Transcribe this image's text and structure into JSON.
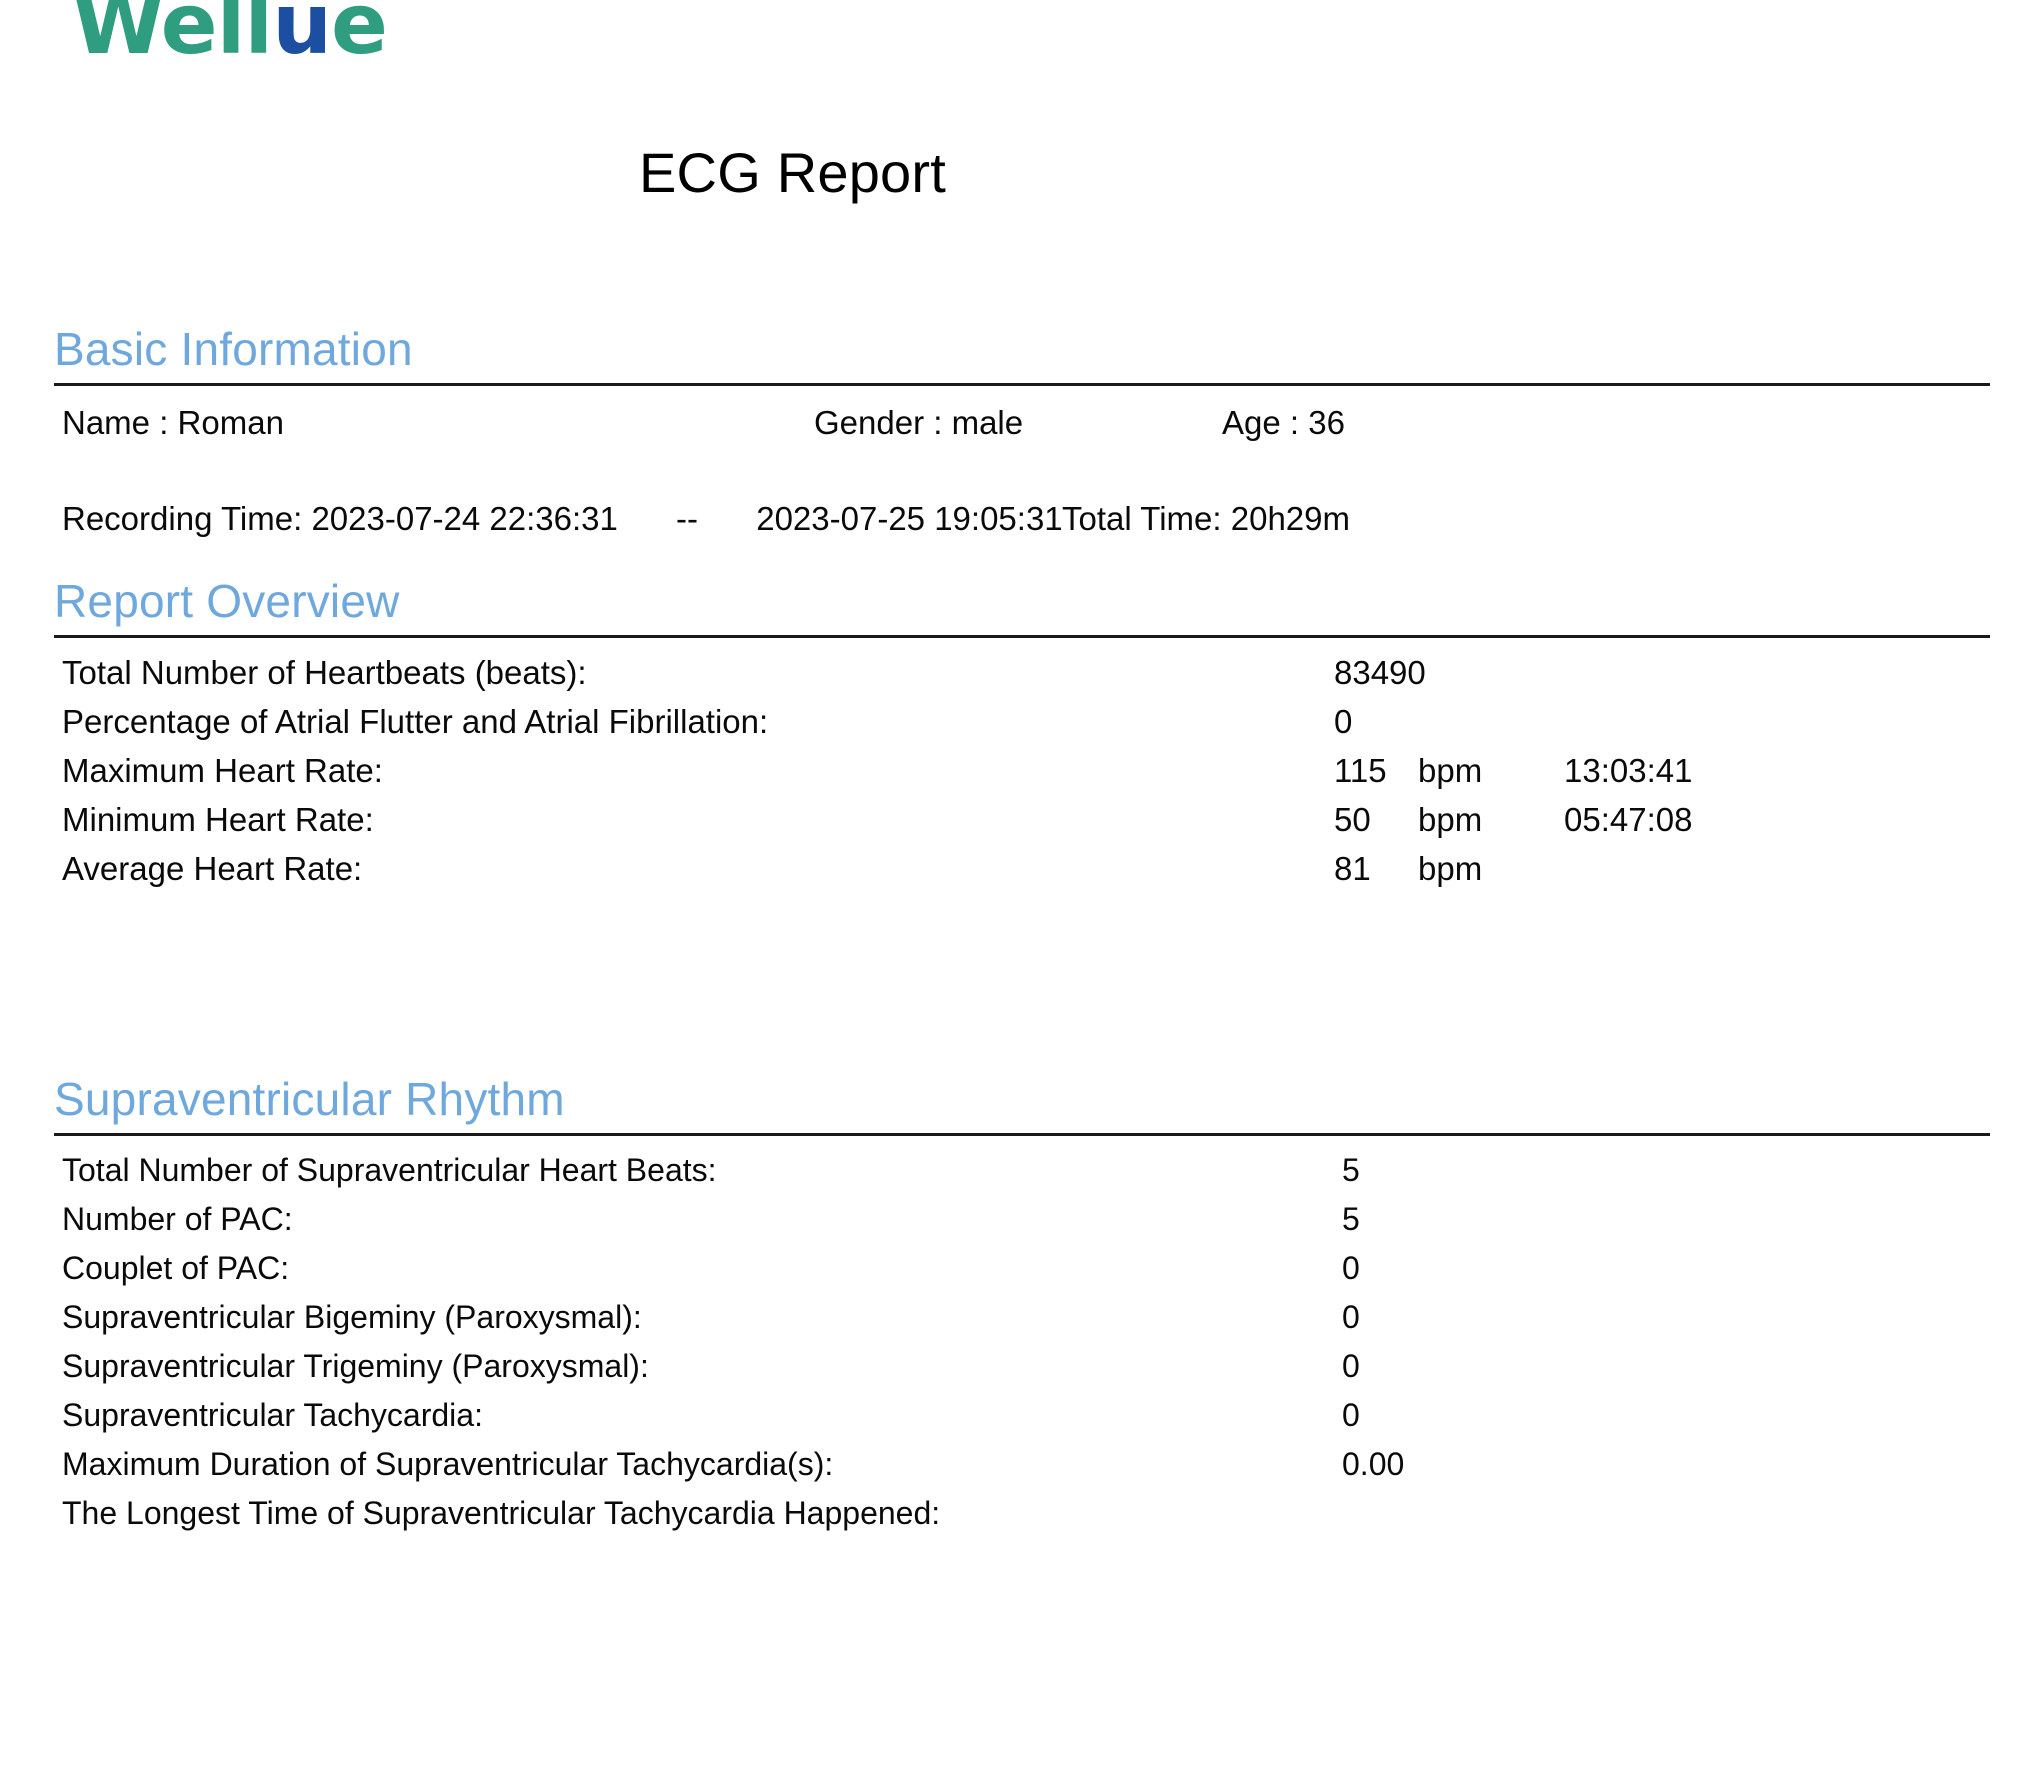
{
  "brand": {
    "logo_part1": "Well",
    "logo_part2": "u",
    "logo_part3": "e",
    "color_green": "#2f9d7f",
    "color_blue": "#1c4fa1"
  },
  "document": {
    "title": "ECG Report",
    "accent_color": "#6fa8dc"
  },
  "basic_information": {
    "heading": "Basic Information",
    "name_label": "Name :",
    "name_value": "Roman",
    "gender_label": "Gender :",
    "gender_value": "male",
    "age_label": "Age :",
    "age_value": "36",
    "recording_time_label": "Recording Time:",
    "recording_start": "2023-07-24 22:36:31",
    "recording_separator": "--",
    "recording_end": "2023-07-25 19:05:31",
    "total_time_label": "Total Time:",
    "total_time_value": "20h29m"
  },
  "report_overview": {
    "heading": "Report Overview",
    "rows": [
      {
        "label": "Total Number of Heartbeats  (beats):",
        "value": "83490",
        "unit": "",
        "time": ""
      },
      {
        "label": "Percentage of Atrial Flutter and Atrial Fibrillation:",
        "value": "0",
        "unit": "",
        "time": ""
      },
      {
        "label": "Maximum Heart Rate:",
        "value": "115",
        "unit": "bpm",
        "time": "13:03:41"
      },
      {
        "label": "Minimum Heart Rate:",
        "value": "50",
        "unit": "bpm",
        "time": "05:47:08"
      },
      {
        "label": "Average Heart Rate:",
        "value": "81",
        "unit": "bpm",
        "time": ""
      }
    ]
  },
  "supraventricular_rhythm": {
    "heading": "Supraventricular Rhythm",
    "rows": [
      {
        "label": "Total Number of Supraventricular Heart Beats:",
        "value": "5"
      },
      {
        "label": "Number of PAC:",
        "value": "5"
      },
      {
        "label": "Couplet of PAC:",
        "value": "0"
      },
      {
        "label": "Supraventricular Bigeminy (Paroxysmal):",
        "value": "0"
      },
      {
        "label": "Supraventricular Trigeminy (Paroxysmal):",
        "value": "0"
      },
      {
        "label": "Supraventricular Tachycardia:",
        "value": "0"
      },
      {
        "label": "Maximum Duration of Supraventricular Tachycardia(s):",
        "value": "0.00"
      },
      {
        "label": "The Longest Time of Supraventricular Tachycardia Happened:",
        "value": ""
      }
    ]
  }
}
